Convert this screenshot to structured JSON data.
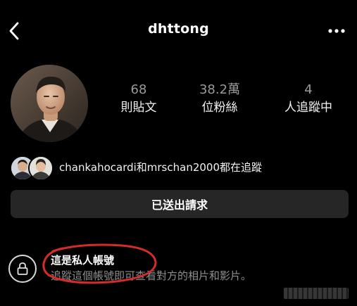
{
  "header": {
    "username": "dhttong",
    "back_icon": "chevron-left-icon",
    "more_icon": "more-horizontal-icon"
  },
  "profile": {
    "avatar_icon": "profile-photo",
    "stats": {
      "posts": {
        "value": "68",
        "label": "則貼文"
      },
      "followers": {
        "value": "38.2萬",
        "label": "位粉絲"
      },
      "following": {
        "value": "4",
        "label": "人追蹤中"
      }
    }
  },
  "mutual": {
    "text": "chankahocardi和mrschan2000都在追蹤",
    "avatars": [
      "mutual-avatar-1",
      "mutual-avatar-2"
    ]
  },
  "request_button": {
    "label": "已送出請求"
  },
  "private_notice": {
    "title": "這是私人帳號",
    "description": "追蹤這個帳號即可查看對方的相片和影片。",
    "lock_icon": "lock-icon"
  },
  "colors": {
    "background": "#000000",
    "button_bg": "#262626",
    "annotation": "#d42b2b",
    "muted_text": "#8e8e8e"
  }
}
